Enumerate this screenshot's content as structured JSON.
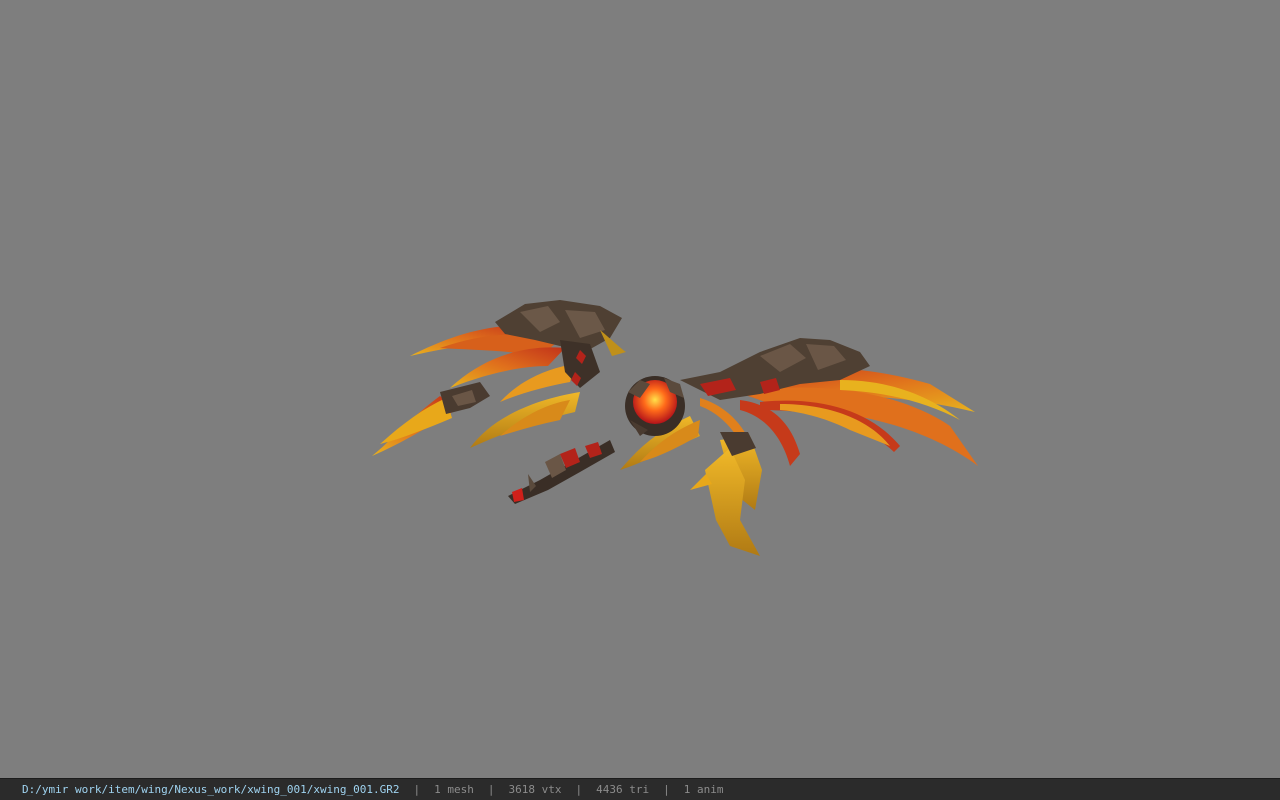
{
  "viewer": {
    "background_color": "#7e7e7e",
    "model_name": "xwing_001",
    "model_colors": {
      "flame_yellow": "#e8a81a",
      "flame_orange": "#d8521a",
      "flame_red": "#b8231a",
      "armor_dark": "#4a3b30",
      "armor_mid": "#6a5646",
      "gem_core": "#ffcf33"
    }
  },
  "statusbar": {
    "file_path": "D:/ymir work/item/wing/Nexus_work/xwing_001/xwing_001.GR2",
    "separator": "|",
    "mesh_count": "1 mesh",
    "vertex_count": "3618 vtx",
    "triangle_count": "4436 tri",
    "anim_count": "1 anim"
  }
}
